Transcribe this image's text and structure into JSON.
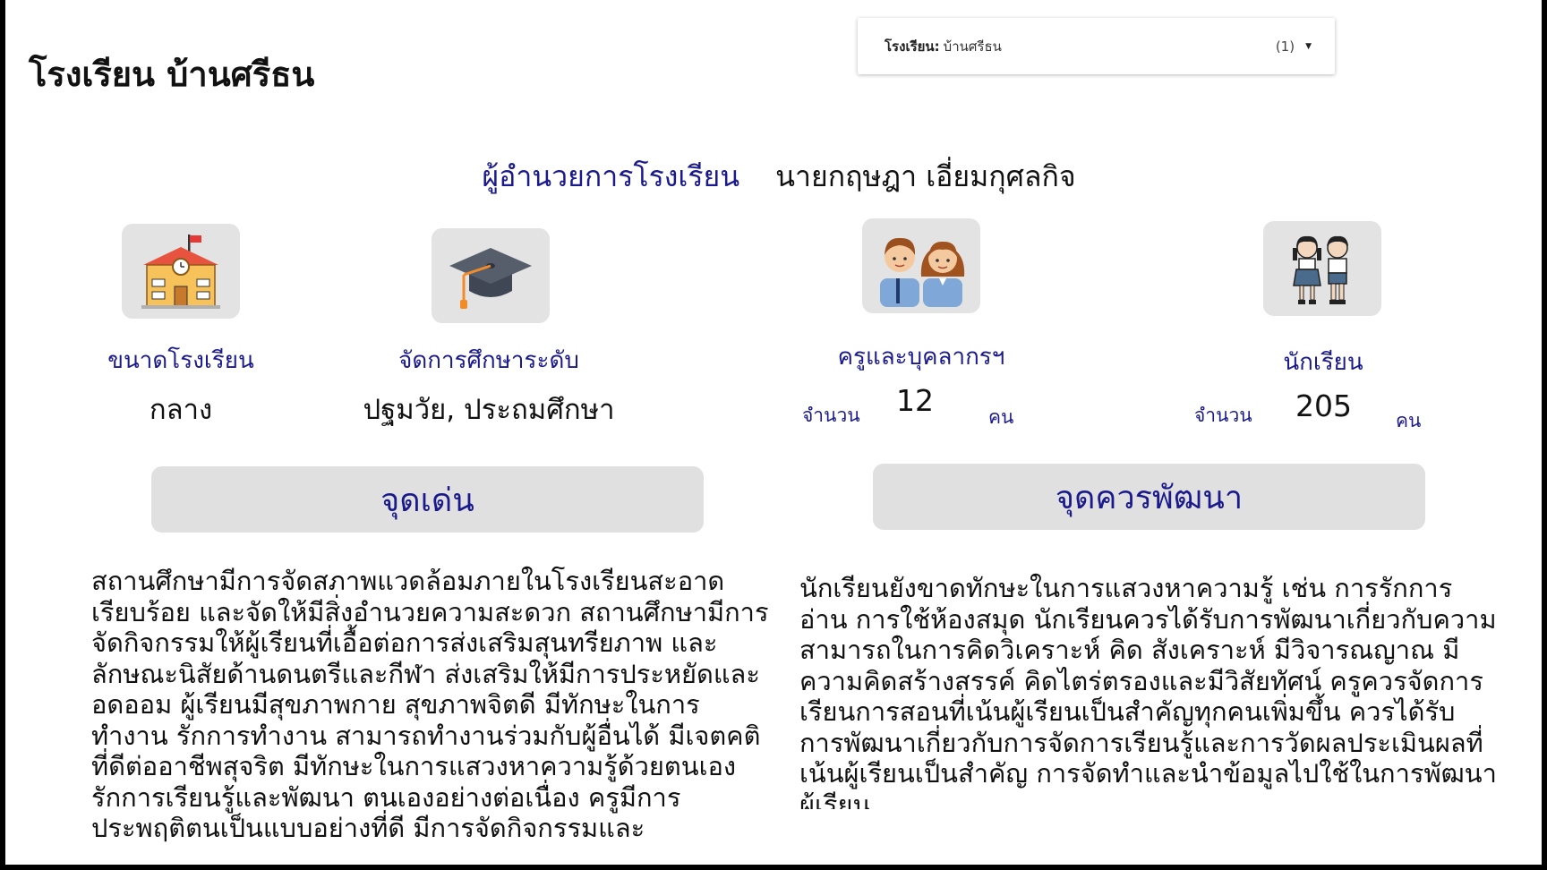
{
  "header": {
    "school_name": "โรงเรียน บ้านศรีธน"
  },
  "filter": {
    "label": "โรงเรียน:",
    "value": "บ้านศรีธน",
    "count": "(1)"
  },
  "director": {
    "label": "ผู้อำนวยการโรงเรียน",
    "name": "นายกฤษฎา เอี่ยมกุศลกิจ"
  },
  "stats": {
    "size": {
      "icon": "school-building-icon",
      "label": "ขนาดโรงเรียน",
      "value": "กลาง"
    },
    "level": {
      "icon": "graduation-cap-icon",
      "label": "จัดการศึกษาระดับ",
      "value": "ปฐมวัย, ประถมศึกษา"
    },
    "staff": {
      "icon": "teachers-icon",
      "label": "ครูและบุคลากรฯ",
      "prefix": "จำนวน",
      "count": "12",
      "unit": "คน"
    },
    "students": {
      "icon": "students-icon",
      "label": "นักเรียน",
      "prefix": "จำนวน",
      "count": "205",
      "unit": "คน"
    }
  },
  "strengths": {
    "heading": "จุดเด่น",
    "text": "สถานศึกษามีการจัดสภาพแวดล้อมภายในโรงเรียนสะอาดเรียบร้อย และจัดให้มีสิ่งอำนวยความสะดวก สถานศึกษามีการจัดกิจกรรมให้ผู้เรียนที่เอื้อต่อการส่งเสริมสุนทรียภาพ และลักษณะนิสัยด้านดนตรีและกีฬา ส่งเสริมให้มีการประหยัดและอดออม ผู้เรียนมีสุขภาพกาย สุขภาพจิตดี มีทักษะในการทำงาน รักการทำงาน สามารถทำงานร่วมกับผู้อื่นได้ มีเจตคติที่ดีต่ออาชีพสุจริต มีทักษะในการแสวงหาความรู้ด้วยตนเอง รักการเรียนรู้และพัฒนา ตนเองอย่างต่อเนื่อง ครูมีการประพฤติตนเป็นแบบอย่างที่ดี มีการจัดกิจกรรมและ"
  },
  "improvements": {
    "heading": "จุดควรพัฒนา",
    "text": "นักเรียนยังขาดทักษะในการแสวงหาความรู้ เช่น การรักการอ่าน การใช้ห้องสมุด นักเรียนควรได้รับการพัฒนาเกี่ยวกับความสามารถในการคิดวิเคราะห์ คิด สังเคราะห์ มีวิจารณญาณ มีความคิดสร้างสรรค์ คิดไตร่ตรองและมีวิสัยทัศน์ ครูควรจัดการเรียนการสอนที่เน้นผู้เรียนเป็นสำคัญทุกคนเพิ่มขึ้น ควรได้รับการพัฒนาเกี่ยวกับการจัดการเรียนรู้และการวัดผลประเมินผลที่เน้นผู้เรียนเป็นสำคัญ การจัดทำและนำข้อมูลไปใช้ในการพัฒนาผู้เรียน"
  }
}
